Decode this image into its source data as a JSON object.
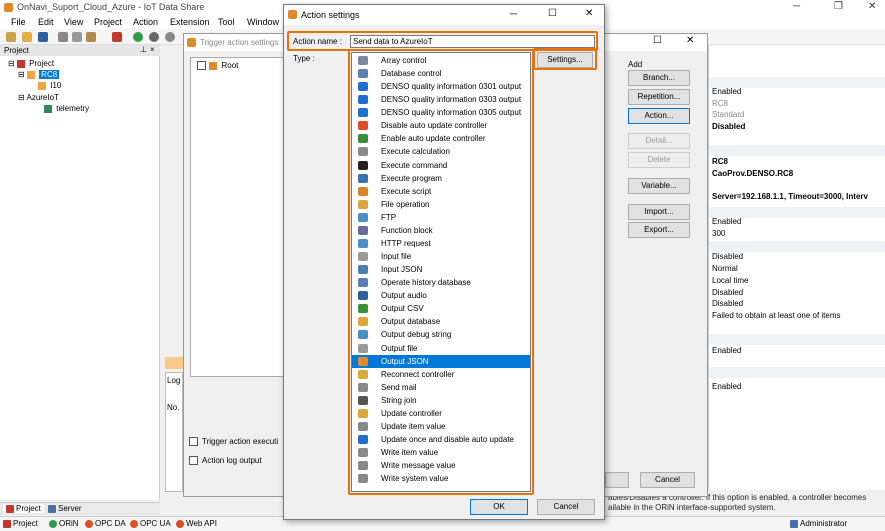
{
  "main": {
    "title": "OnNavi_Suport_Cloud_Azure - IoT Data Share",
    "menu": [
      "File",
      "Edit",
      "View",
      "Project",
      "Action",
      "Extension",
      "Tool",
      "Window"
    ]
  },
  "project_panel": {
    "header": "Project",
    "tree": {
      "root": "Project",
      "controller": "RC8",
      "child": "I10",
      "cloud": "AzureIoT",
      "telemetry": "telemetry"
    },
    "tabs": {
      "project": "Project",
      "server": "Server"
    }
  },
  "status": {
    "orin": "ORiN",
    "opcda": "OPC DA",
    "opcua": "OPC UA",
    "webapi": "Web API",
    "user": "Administrator"
  },
  "trigger": {
    "title": "Trigger action settings",
    "root": "Root",
    "add_label": "Add",
    "buttons": {
      "branch": "Branch...",
      "repetition": "Repetition...",
      "action": "Action...",
      "detail": "Detail...",
      "delete": "Delete",
      "variable": "Variable...",
      "import": "Import...",
      "export": "Export...",
      "cancel": "Cancel"
    },
    "checks": {
      "exec": "Trigger action executi",
      "log": "Action log output"
    },
    "log_tab": "Log",
    "log_col": "No."
  },
  "properties": {
    "rows": [
      "Enabled",
      "RC8",
      "Standard",
      "Disabled",
      "RC8",
      "CaoProv.DENSO.RC8",
      "Server=192.168.1.1, Timeout=3000, Interv",
      "Enabled",
      "300",
      "Disabled",
      "Normal",
      "Local time",
      "Disabled",
      "Disabled",
      "Failed to obtain at least one of items",
      "Enabled",
      "Enabled"
    ],
    "desc1": "ables/Disables a controller. If this option is enabled, a controller becomes",
    "desc2": "ailable in the ORiN interface-supported system."
  },
  "dialog": {
    "title": "Action settings",
    "name_label": "Action name :",
    "name_value": "Send data to AzureIoT",
    "type_label": "Type :",
    "settings_btn": "Settings...",
    "ok": "OK",
    "cancel": "Cancel",
    "selected": "Output JSON",
    "types": [
      {
        "label": "Array control",
        "color": "#7a8aa0"
      },
      {
        "label": "Database control",
        "color": "#5b7fb0"
      },
      {
        "label": "DENSO quality information 0301 output",
        "color": "#1f6fd1"
      },
      {
        "label": "DENSO quality information 0303 output",
        "color": "#1f6fd1"
      },
      {
        "label": "DENSO quality information 0305 output",
        "color": "#1f6fd1"
      },
      {
        "label": "Disable auto update controller",
        "color": "#e04b2a"
      },
      {
        "label": "Enable auto update controller",
        "color": "#3a8f3a"
      },
      {
        "label": "Execute calculation",
        "color": "#8a8a8a"
      },
      {
        "label": "Execute command",
        "color": "#222222"
      },
      {
        "label": "Execute program",
        "color": "#3a6fb0"
      },
      {
        "label": "Execute script",
        "color": "#d9822b"
      },
      {
        "label": "File operation",
        "color": "#d9a93b"
      },
      {
        "label": "FTP",
        "color": "#4a8fc8"
      },
      {
        "label": "Function block",
        "color": "#6a6a9a"
      },
      {
        "label": "HTTP request",
        "color": "#4a8fc8"
      },
      {
        "label": "Input file",
        "color": "#9a9a9a"
      },
      {
        "label": "Input JSON",
        "color": "#4a7fb0"
      },
      {
        "label": "Operate history database",
        "color": "#5b7fb0"
      },
      {
        "label": "Output audio",
        "color": "#2f5f9f"
      },
      {
        "label": "Output CSV",
        "color": "#3a8f3a"
      },
      {
        "label": "Output database",
        "color": "#d9a93b"
      },
      {
        "label": "Output debug string",
        "color": "#4a8fc8"
      },
      {
        "label": "Output file",
        "color": "#9a9a9a"
      },
      {
        "label": "Output JSON",
        "color": "#e08a2a"
      },
      {
        "label": "Reconnect controller",
        "color": "#d9a93b"
      },
      {
        "label": "Send mail",
        "color": "#8a8a8a"
      },
      {
        "label": "String join",
        "color": "#555555"
      },
      {
        "label": "Update controller",
        "color": "#d9a93b"
      },
      {
        "label": "Update item value",
        "color": "#8a8a8a"
      },
      {
        "label": "Update once and disable auto update",
        "color": "#1f6fd1"
      },
      {
        "label": "Write item value",
        "color": "#8a8a8a"
      },
      {
        "label": "Write message value",
        "color": "#8a8a8a"
      },
      {
        "label": "Write system value",
        "color": "#8a8a8a"
      }
    ]
  }
}
